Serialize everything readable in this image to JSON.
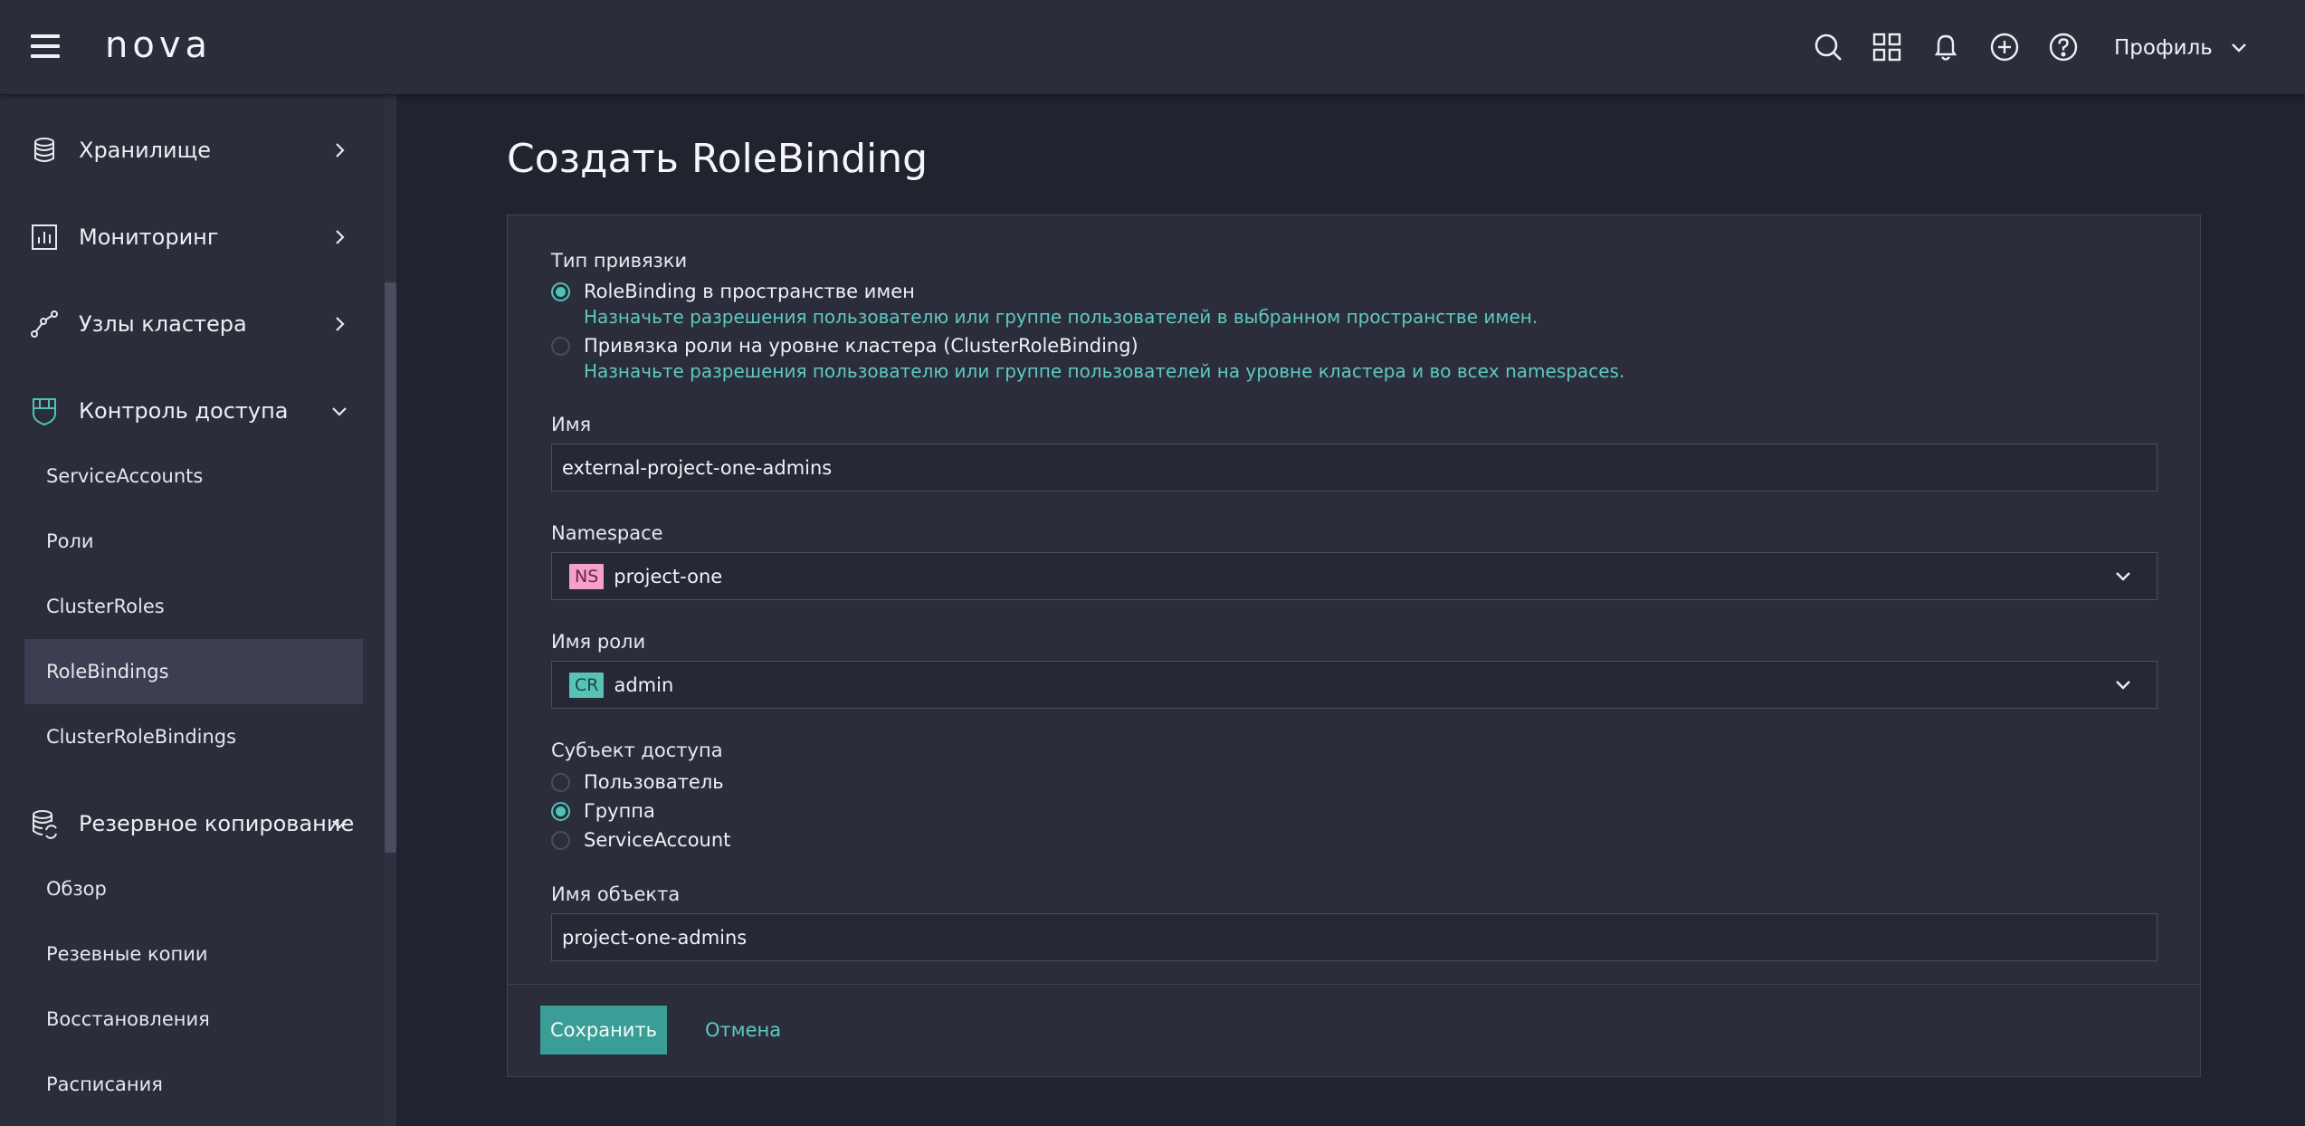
{
  "topbar": {
    "logo": "nova",
    "icons": [
      "search-icon",
      "apps-grid-icon",
      "bell-icon",
      "plus-circle-icon",
      "help-icon"
    ],
    "profile_label": "Профиль"
  },
  "sidebar": {
    "groups": [
      {
        "label": "Хранилище",
        "icon": "database-icon",
        "expanded": false
      },
      {
        "label": "Мониторинг",
        "icon": "chart-icon",
        "expanded": false
      },
      {
        "label": "Узлы кластера",
        "icon": "nodes-icon",
        "expanded": false
      },
      {
        "label": "Контроль доступа",
        "icon": "shield-icon",
        "expanded": true
      },
      {
        "label": "Резервное копирование",
        "icon": "backup-database-icon",
        "expanded": true
      }
    ],
    "access_items": [
      "ServiceAccounts",
      "Роли",
      "ClusterRoles",
      "RoleBindings",
      "ClusterRoleBindings"
    ],
    "backup_items": [
      "Обзор",
      "Резевные копии",
      "Восстановления",
      "Расписания"
    ],
    "active_item": "RoleBindings"
  },
  "page": {
    "title": "Создать RoleBinding"
  },
  "form": {
    "binding_type": {
      "label": "Тип привязки",
      "options": [
        {
          "label": "RoleBinding в пространстве имен",
          "hint": "Назначьте разрешения пользователю или группе пользователей в выбранном пространстве имен.",
          "checked": true
        },
        {
          "label": "Привязка роли на уровне кластера (ClusterRoleBinding)",
          "hint": "Назначьте разрешения пользователю или группе пользователей на уровне кластера и во всех namespaces.",
          "checked": false
        }
      ]
    },
    "name": {
      "label": "Имя",
      "value": "external-project-one-admins"
    },
    "namespace": {
      "label": "Namespace",
      "badge": "NS",
      "value": "project-one"
    },
    "role_name": {
      "label": "Имя роли",
      "badge": "CR",
      "value": "admin"
    },
    "subject": {
      "label": "Субъект доступа",
      "options": [
        {
          "label": "Пользователь",
          "checked": false
        },
        {
          "label": "Группа",
          "checked": true
        },
        {
          "label": "ServiceAccount",
          "checked": false
        }
      ]
    },
    "object_name": {
      "label": "Имя объекта",
      "value": "project-one-admins"
    }
  },
  "actions": {
    "save_label": "Сохранить",
    "cancel_label": "Отмена"
  },
  "colors": {
    "accent": "#3a9e96",
    "hint_text": "#5ec9c0",
    "ns_badge": "#f4a0c8",
    "cr_badge": "#59c2b6",
    "background": "#21232f",
    "panel": "#2b2d3b"
  }
}
